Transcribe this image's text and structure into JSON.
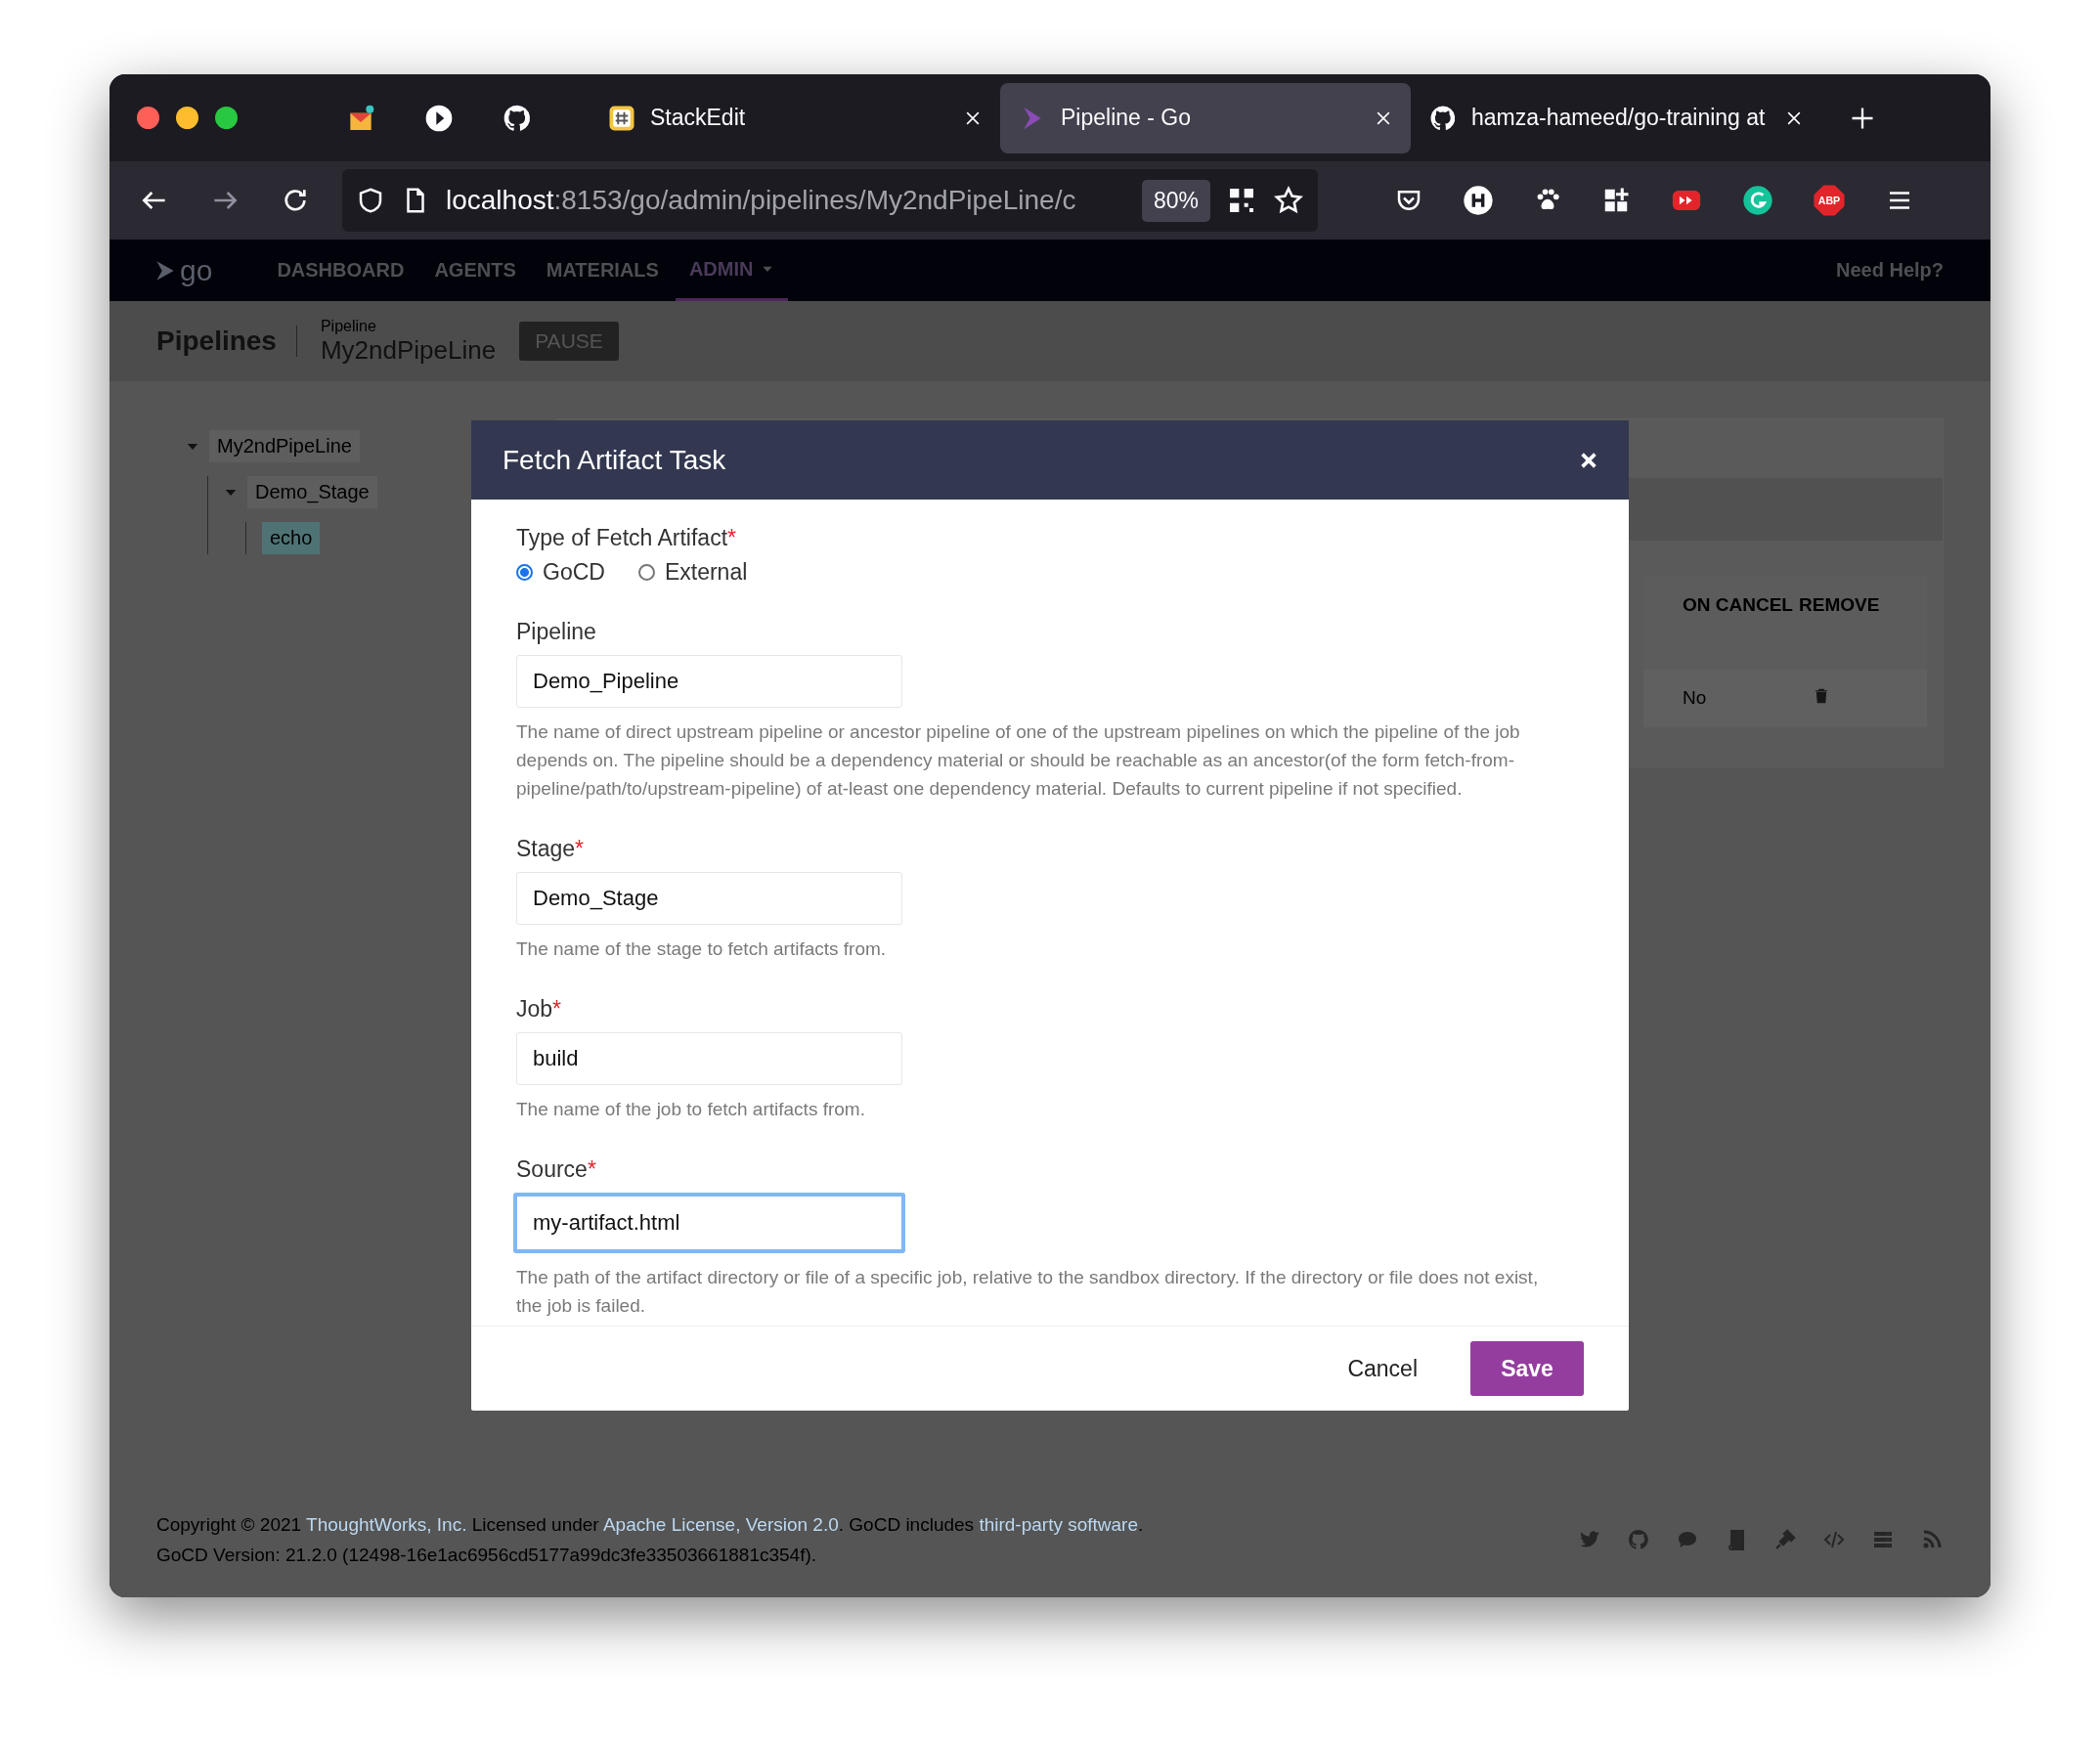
{
  "browser": {
    "tabs": [
      {
        "title": "StackEdit",
        "selected": false
      },
      {
        "title": "Pipeline - Go",
        "selected": true
      },
      {
        "title": "hamza-hameed/go-training at",
        "selected": false
      }
    ],
    "adblock_label": "ABP",
    "url": {
      "host": "localhost",
      "path": ":8153/go/admin/pipelines/My2ndPipeLine/c"
    },
    "zoom": "80%"
  },
  "nav": {
    "logo": "go",
    "items": [
      {
        "label": "DASHBOARD",
        "selected": false
      },
      {
        "label": "AGENTS",
        "selected": false
      },
      {
        "label": "MATERIALS",
        "selected": false
      },
      {
        "label": "ADMIN",
        "selected": true
      }
    ],
    "help": "Need Help?"
  },
  "header": {
    "title": "Pipelines",
    "crumb_label": "Pipeline",
    "crumb_name": "My2ndPipeLine",
    "button": "PAUSE"
  },
  "tree": [
    {
      "label": "My2ndPipeLine",
      "expanded": true,
      "selected": false,
      "children": [
        {
          "label": "Demo_Stage",
          "expanded": true,
          "selected": false,
          "children": [
            {
              "label": "echo",
              "selected": true
            }
          ]
        }
      ]
    }
  ],
  "table": {
    "columns": [
      "ON CANCEL",
      "REMOVE"
    ],
    "rows": [
      [
        "No"
      ]
    ]
  },
  "modal": {
    "title": "Fetch Artifact Task",
    "type": {
      "label": "Type of Fetch Artifact",
      "mark": "*",
      "options": [
        {
          "label": "GoCD",
          "selected": true
        },
        {
          "label": "External",
          "selected": false
        }
      ]
    },
    "fields": [
      {
        "label": "Pipeline",
        "value": "Demo_Pipeline",
        "focused": false,
        "help": "The name of direct upstream pipeline or ancestor pipeline of one of the upstream pipelines on which the pipeline of the job depends on. The pipeline should be a dependency material or should be reachable as an ancestor(of the form fetch-from-pipeline/path/to/upstream-pipeline) of at-least one dependency material. Defaults to current pipeline if not specified."
      },
      {
        "label": "Stage",
        "mark": "*",
        "value": "Demo_Stage",
        "focused": false,
        "help": "The name of the stage to fetch artifacts from."
      },
      {
        "label": "Job",
        "mark": "*",
        "value": "build",
        "focused": false,
        "help": "The name of the job to fetch artifacts from."
      },
      {
        "label": "Source",
        "mark": "*",
        "value": "my-artifact.html",
        "focused": true,
        "help": "The path of the artifact directory or file of a specific job, relative to the sandbox directory. If the directory or file does not exist, the job is failed."
      }
    ],
    "cancel": "Cancel",
    "save": "Save"
  },
  "footer": {
    "line1": [
      {
        "kind": "text",
        "text": "Copyright © 2021 "
      },
      {
        "kind": "link",
        "text": "ThoughtWorks, Inc."
      },
      {
        "kind": "text",
        "text": " Licensed under "
      },
      {
        "kind": "link",
        "text": "Apache License, Version 2.0"
      },
      {
        "kind": "text",
        "text": ". GoCD includes "
      },
      {
        "kind": "link",
        "text": "third-party software"
      },
      {
        "kind": "text",
        "text": "."
      }
    ],
    "line2": "GoCD Version: 21.2.0 (12498-16e1ac6956cd5177a99dc3fe33503661881c354f)."
  }
}
